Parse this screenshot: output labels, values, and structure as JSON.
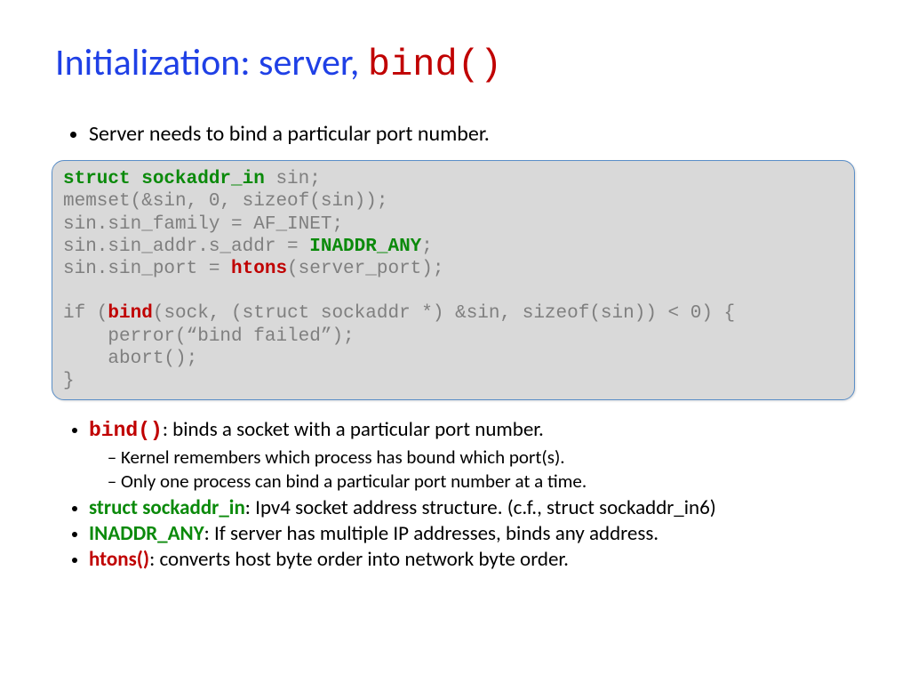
{
  "title": {
    "part1": "Initialization: server, ",
    "part2": "bind()"
  },
  "bullet1": "Server needs to bind a particular port number.",
  "code": {
    "l1_a": "struct sockaddr_in",
    "l1_b": " sin;",
    "l2": "memset(&sin, 0, sizeof(sin));",
    "l3": "sin.sin_family = AF_INET;",
    "l4_a": "sin.sin_addr.s_addr = ",
    "l4_b": "INADDR_ANY",
    "l4_c": ";",
    "l5_a": "sin.sin_port = ",
    "l5_b": "htons",
    "l5_c": "(server_port);",
    "blank": "",
    "l6_a": "if (",
    "l6_b": "bind",
    "l6_c": "(sock, (struct sockaddr *) &sin, sizeof(sin)) < 0) {",
    "l7": "    perror(“bind failed”);",
    "l8": "    abort();",
    "l9": "}"
  },
  "notes": {
    "n1_term": "bind()",
    "n1_text": ": binds a socket with a particular port number.",
    "n1_sub1": "Kernel remembers which process has bound which port(s).",
    "n1_sub2": "Only one process can bind a particular port number at a time.",
    "n2_term": "struct sockaddr_in",
    "n2_text": ": Ipv4 socket address structure. (c.f., struct sockaddr_in6)",
    "n3_term": "INADDR_ANY",
    "n3_text": ": If server has multiple IP addresses, binds any address.",
    "n4_term": "htons()",
    "n4_text": ": converts host byte order into network byte order."
  }
}
